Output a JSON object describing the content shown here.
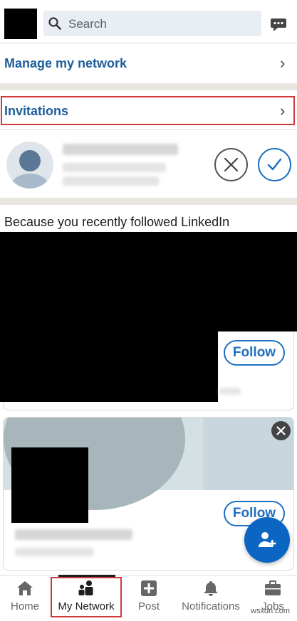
{
  "header": {
    "search_placeholder": "Search"
  },
  "manage_network": {
    "label": "Manage my network"
  },
  "invitations": {
    "label": "Invitations"
  },
  "suggestions": {
    "title": "Because you recently followed LinkedIn",
    "follow_label": "Follow"
  },
  "bottom_nav": {
    "items": [
      {
        "label": "Home",
        "icon": "home-icon"
      },
      {
        "label": "My Network",
        "icon": "people-icon"
      },
      {
        "label": "Post",
        "icon": "plus-square-icon"
      },
      {
        "label": "Notifications",
        "icon": "bell-icon"
      },
      {
        "label": "Jobs",
        "icon": "briefcase-icon"
      }
    ]
  },
  "watermark": "wsxdn.com",
  "colors": {
    "accent": "#0a66c2",
    "link": "#1e5e9b",
    "highlight": "#d03a3a"
  }
}
